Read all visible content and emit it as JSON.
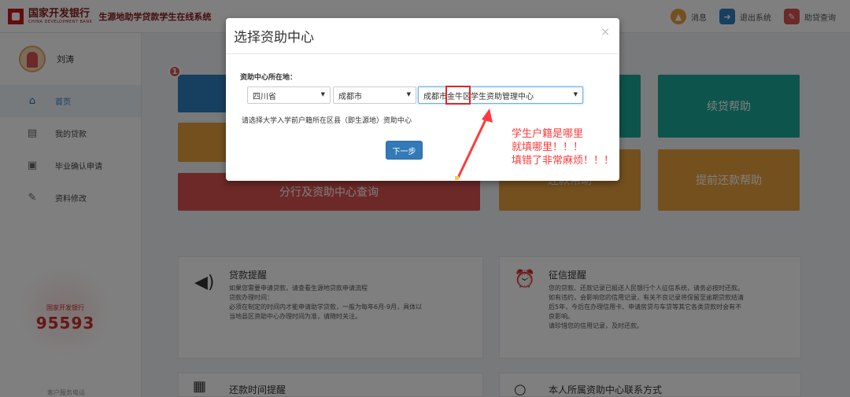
{
  "topbar": {
    "bank_name": "国家开发银行",
    "bank_en": "CHINA DEVELOPMENT BANK",
    "system_title": "生源地助学贷款学生在线系统",
    "actions": [
      {
        "icon": "bell-icon",
        "label": "消息",
        "color": "#e8a13c"
      },
      {
        "icon": "logout-icon",
        "label": "退出系统",
        "color": "#2f7fc1"
      },
      {
        "icon": "edit-icon",
        "label": "助贷查询",
        "color": "#d9534f"
      }
    ]
  },
  "sidebar": {
    "user_name": "刘涛",
    "items": [
      {
        "label": "首页",
        "icon": "home-icon",
        "active": true
      },
      {
        "label": "我的贷款",
        "icon": "list-icon",
        "active": false
      },
      {
        "label": "毕业确认申请",
        "icon": "folder-icon",
        "active": false
      },
      {
        "label": "资料修改",
        "icon": "edit-icon",
        "active": false
      }
    ],
    "hotline_label": "国家开发银行",
    "hotline_number": "95593",
    "hotline_sub": "客户服务电话"
  },
  "badge": "1",
  "tiles": {
    "continue_help": "续贷帮助",
    "prepay_help": "提前还款帮助",
    "branch_query": "分行及资助中心查询",
    "other_tile": "还款帮助"
  },
  "panels": {
    "loan_reminder": {
      "title": "贷款提醒",
      "lines": [
        "如果您需要申请贷款，请查看生源地贷款申请流程",
        "贷款办理时间：",
        "必须在制定的时间内才能申请助学贷款，一般为每年6月-9月，具体以",
        "当地县区资助中心办理时间为准，请随时关注。"
      ]
    },
    "credit_reminder": {
      "title": "征信提醒",
      "lines": [
        "您的贷款、还款记录已报送人民银行个人征信系统，请务必按时还款。",
        "如有违约，会影响您的信用记录，有关不良记录将保留至逾期贷款结清",
        "后5年，今后在办理信用卡、申请房贷与车贷等其它各类贷款时会有不",
        "良影响。",
        "请珍惜您的信用记录，及时还款。"
      ]
    },
    "repay_time": {
      "title": "还款时间提醒"
    },
    "center_contact": {
      "title": "本人所属资助中心联系方式"
    }
  },
  "modal": {
    "title": "选择资助中心",
    "close": "×",
    "field_label": "资助中心所在地：",
    "province": "四川省",
    "city": "成都市",
    "center": "成都市金牛区学生资助管理中心",
    "hint": "请选择大学入学前户籍所在区县（即生源地）资助中心",
    "next_button": "下一步"
  },
  "annotation": {
    "lines": [
      "学生户籍是哪里",
      "就填哪里！！！",
      "填错了非常麻烦！！！"
    ],
    "color": "#ff3b3b"
  }
}
